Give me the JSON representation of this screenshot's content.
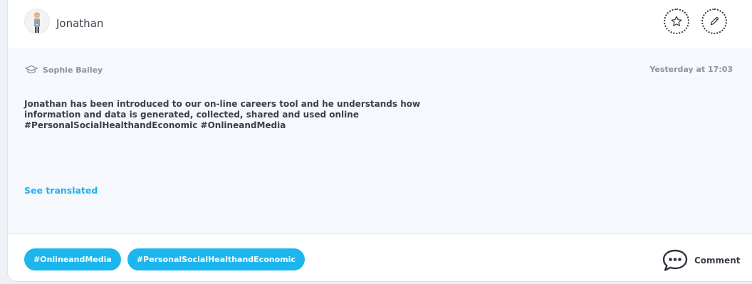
{
  "header": {
    "student_name": "Jonathan",
    "favorite_icon": "star-icon",
    "edit_icon": "pencil-icon"
  },
  "post": {
    "author_icon": "graduation-cap-icon",
    "author": "Sophie Bailey",
    "timestamp": "Yesterday at 17:03",
    "text": "Jonathan has been introduced to our on-line careers tool and he understands how\ninformation and data is generated, collected, shared and used online\n#PersonalSocialHealthandEconomic  #OnlineandMedia",
    "see_translated": "See translated"
  },
  "footer": {
    "tags": [
      "#OnlineandMedia",
      "#PersonalSocialHealthandEconomic"
    ],
    "comment_icon": "speech-bubble-icon",
    "comment_label": "Comment"
  },
  "colors": {
    "accent": "#1cb6ee",
    "text": "#3a3f4a",
    "muted": "#8a93a0",
    "post_background": "#f5f8fc"
  }
}
